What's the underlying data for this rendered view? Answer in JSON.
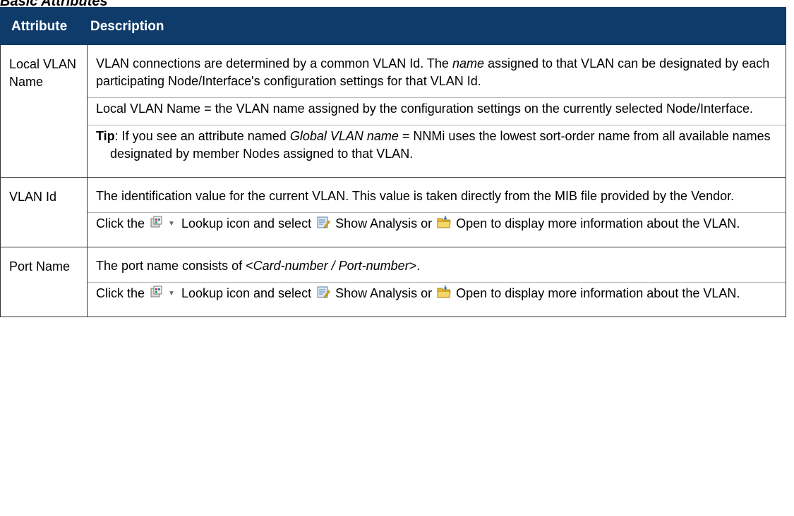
{
  "section": {
    "heading": "Basic Attributes"
  },
  "table": {
    "header": {
      "attribute": "Attribute",
      "description": "Description"
    },
    "rows": [
      {
        "attribute": "Local VLAN Name",
        "p1": {
          "a": "VLAN connections are determined by a common VLAN Id. The ",
          "b": "name",
          "c": " assigned to that VLAN can be designated by each participating Node/Interface's configuration settings for that VLAN Id."
        },
        "p2": "Local VLAN Name = the VLAN name assigned by the configuration settings on the currently selected Node/Interface.",
        "tip": {
          "label": "Tip",
          "a": ": If you see an attribute named ",
          "b": "Global VLAN name",
          "c": " = NNMi uses the lowest sort-order name from all available names designated by member Nodes assigned to that VLAN."
        }
      },
      {
        "attribute": "VLAN Id",
        "p1": "The identification value for the current VLAN. This value is taken directly from the MIB file provided by the Vendor.",
        "p2": {
          "a": "Click the ",
          "lookup": " Lookup icon and select ",
          "analysis": " Show Analysis or ",
          "open": " Open to display more information about the VLAN."
        }
      },
      {
        "attribute": "Port Name",
        "p1": {
          "a": "The port name consists of <",
          "b": "Card-number / Port-number",
          "c": ">."
        },
        "p2": {
          "a": "Click the ",
          "lookup": " Lookup icon and select ",
          "analysis": " Show Analysis or ",
          "open": " Open to display more information about the VLAN."
        }
      }
    ]
  },
  "icons": {
    "lookup": "lookup-icon",
    "dropdown": "chevron-down-icon",
    "analysis": "show-analysis-icon",
    "open": "open-folder-icon"
  },
  "colors": {
    "header_bg": "#0f3b6b",
    "header_text": "#ffffff",
    "border": "#333333"
  }
}
